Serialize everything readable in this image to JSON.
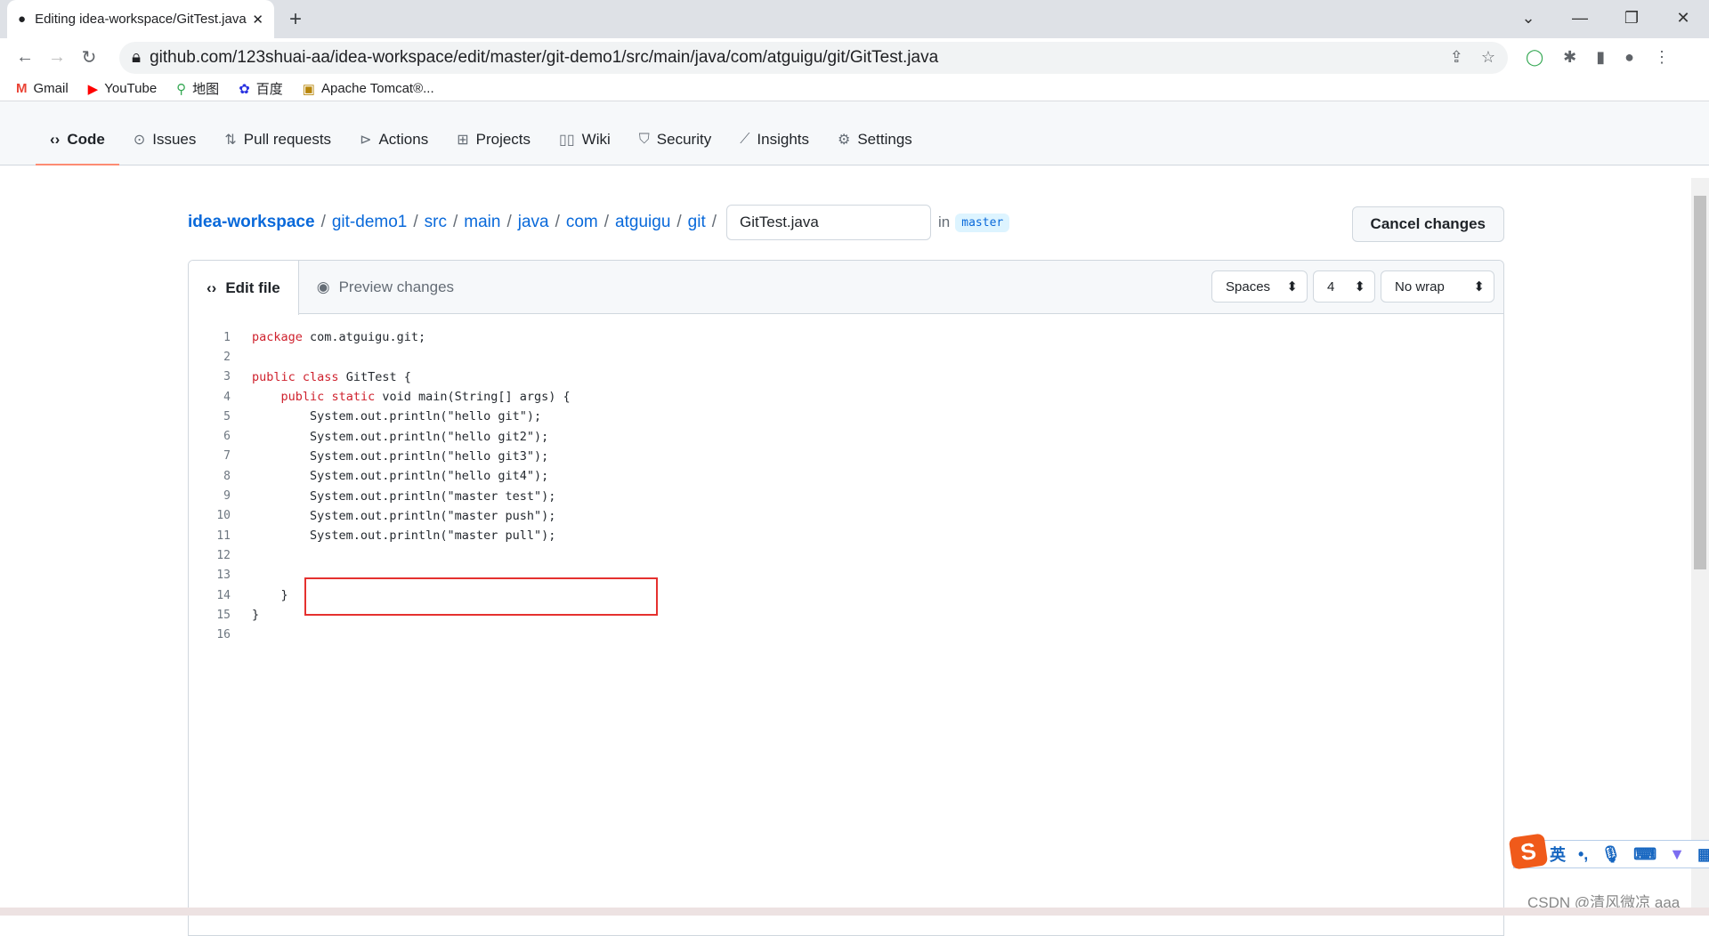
{
  "browser": {
    "tab_title": "Editing idea-workspace/GitTest.java",
    "url": "github.com/123shuai-aa/idea-workspace/edit/master/git-demo1/src/main/java/com/atguigu/git/GitTest.java",
    "bookmarks": [
      {
        "label": "Gmail",
        "icon": "gmail-icon"
      },
      {
        "label": "YouTube",
        "icon": "youtube-icon"
      },
      {
        "label": "地图",
        "icon": "maps-icon"
      },
      {
        "label": "百度",
        "icon": "baidu-icon"
      },
      {
        "label": "Apache Tomcat®...",
        "icon": "tomcat-icon"
      }
    ]
  },
  "repo_nav": [
    {
      "label": "Code",
      "icon": "code-icon",
      "selected": true
    },
    {
      "label": "Issues",
      "icon": "issue-icon"
    },
    {
      "label": "Pull requests",
      "icon": "pull-request-icon"
    },
    {
      "label": "Actions",
      "icon": "play-icon"
    },
    {
      "label": "Projects",
      "icon": "table-icon"
    },
    {
      "label": "Wiki",
      "icon": "book-icon"
    },
    {
      "label": "Security",
      "icon": "shield-icon"
    },
    {
      "label": "Insights",
      "icon": "graph-icon"
    },
    {
      "label": "Settings",
      "icon": "gear-icon"
    }
  ],
  "breadcrumb": [
    "idea-workspace",
    "git-demo1",
    "src",
    "main",
    "java",
    "com",
    "atguigu",
    "git"
  ],
  "filename": "GitTest.java",
  "in_label": "in",
  "branch": "master",
  "cancel_label": "Cancel changes",
  "editor": {
    "tabs": [
      "Edit file",
      "Preview changes"
    ],
    "indent_mode": "Spaces",
    "indent_size": "4",
    "wrap_mode": "No wrap",
    "lines": [
      "package com.atguigu.git;",
      "",
      "public class GitTest {",
      "    public static void main(String[] args) {",
      "        System.out.println(\"hello git\");",
      "        System.out.println(\"hello git2\");",
      "        System.out.println(\"hello git3\");",
      "        System.out.println(\"hello git4\");",
      "        System.out.println(\"master test\");",
      "        System.out.println(\"master push\");",
      "        System.out.println(\"master pull\");",
      "",
      "",
      "    }",
      "}",
      ""
    ],
    "highlight_color": "#e5312f"
  },
  "ime": {
    "lang": "英",
    "punct": "•,"
  },
  "watermark": "CSDN @清风微凉 aaa"
}
